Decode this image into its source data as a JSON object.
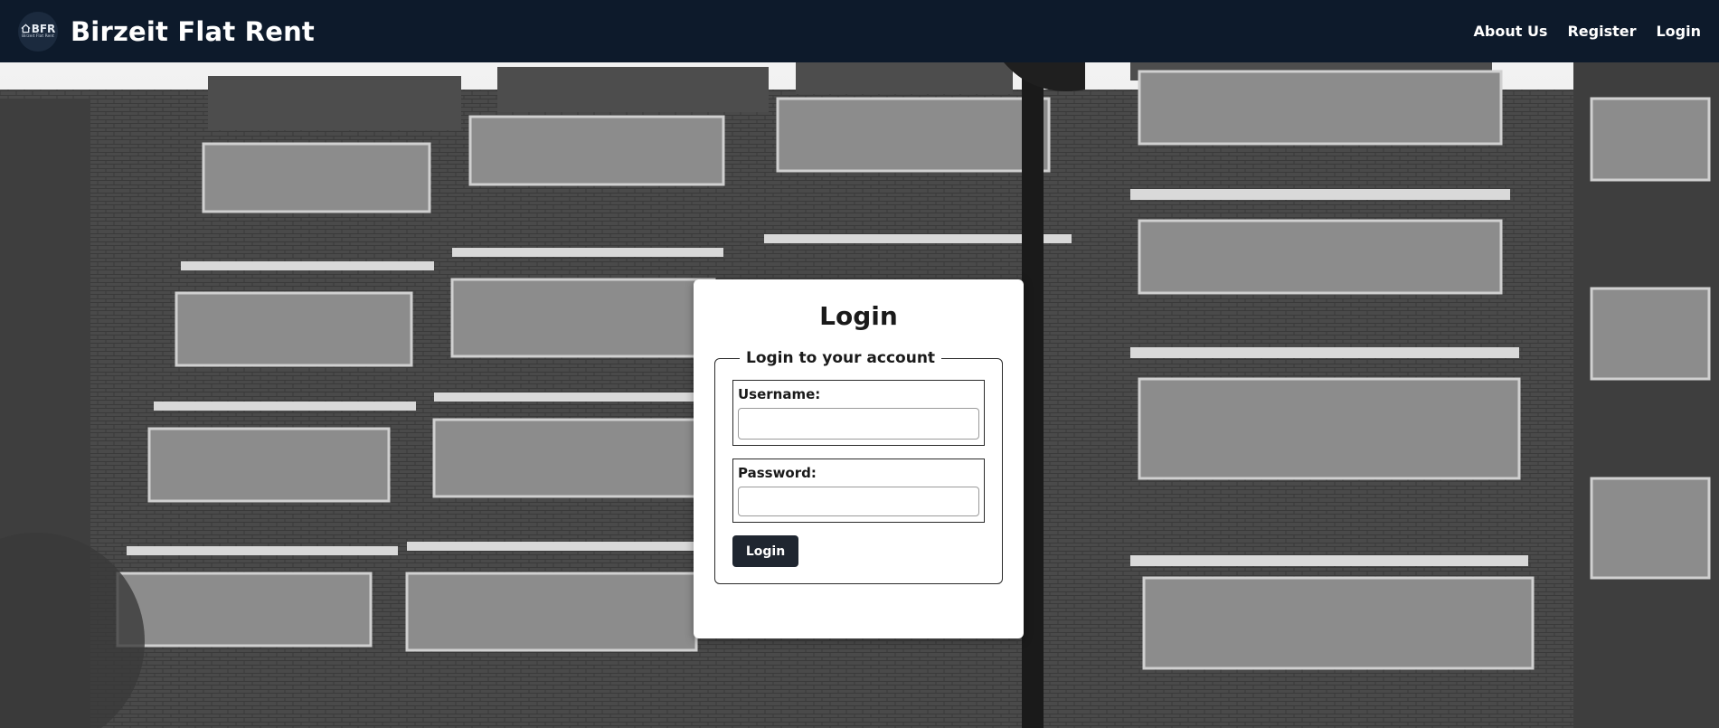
{
  "header": {
    "logo_text": "BFR",
    "logo_subtext": "Birzeit Flat Rent",
    "site_title": "Birzeit Flat Rent",
    "nav": [
      {
        "label": "About Us"
      },
      {
        "label": "Register"
      },
      {
        "label": "Login"
      }
    ]
  },
  "login": {
    "title": "Login",
    "legend": "Login to your account",
    "username_label": "Username:",
    "username_value": "",
    "password_label": "Password:",
    "password_value": "",
    "submit_label": "Login"
  },
  "colors": {
    "header_bg": "#0d1a2b",
    "button_bg": "#1f2630",
    "card_bg": "#ffffff"
  }
}
